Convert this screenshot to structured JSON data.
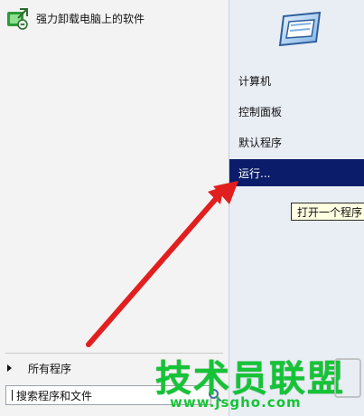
{
  "left_pane": {
    "pinned_program": {
      "label": "强力卸载电脑上的软件",
      "icon": "uninstaller-app-icon"
    },
    "all_programs": {
      "label": "所有程序"
    },
    "search": {
      "placeholder": "搜索程序和文件",
      "icon": "search-icon"
    }
  },
  "right_pane": {
    "user_tile_icon": "window-picture-icon",
    "items": [
      {
        "label": "计算机"
      },
      {
        "label": "控制面板"
      },
      {
        "label": "默认程序"
      },
      {
        "label": "运行..."
      }
    ],
    "selected_index": 3,
    "tooltip": "打开一个程序"
  },
  "overlay": {
    "arrow_icon": "red-arrow-icon",
    "arrow_color": "#e21f1f"
  },
  "watermark": {
    "title": "技术员联盟",
    "url": "www.jsgho.com",
    "color": "#15c436"
  }
}
